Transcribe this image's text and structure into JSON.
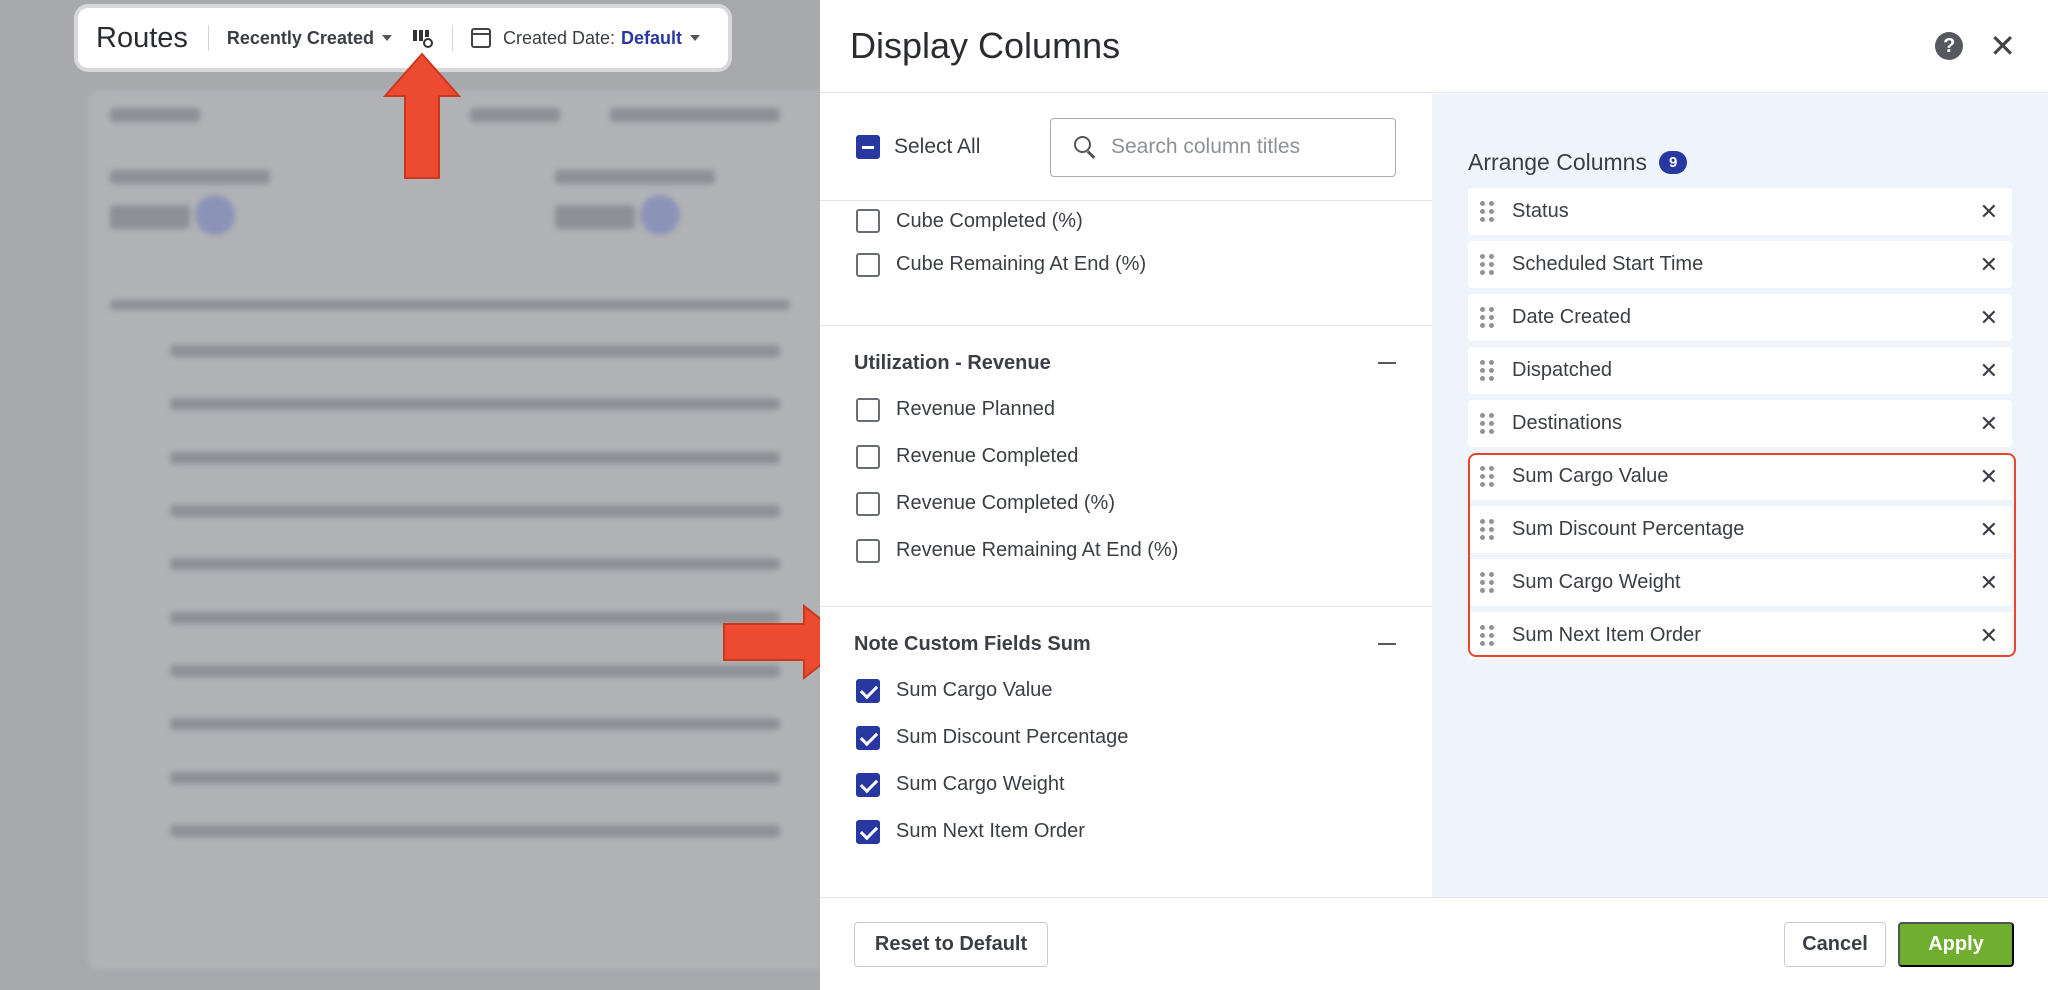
{
  "toolbar": {
    "title": "Routes",
    "sort_label": "Recently Created",
    "date_label": "Created Date:",
    "date_value": "Default",
    "column_settings_icon": "columns-gear-icon",
    "calendar_icon": "calendar-icon"
  },
  "modal": {
    "title": "Display Columns",
    "select_all_label": "Select All",
    "search_placeholder": "Search column titles",
    "groups": [
      {
        "title": "",
        "options": [
          {
            "label": "Cube Completed (%)",
            "checked": false
          },
          {
            "label": "Cube Remaining At End (%)",
            "checked": false
          }
        ]
      },
      {
        "title": "Utilization - Revenue",
        "options": [
          {
            "label": "Revenue Planned",
            "checked": false
          },
          {
            "label": "Revenue Completed",
            "checked": false
          },
          {
            "label": "Revenue Completed (%)",
            "checked": false
          },
          {
            "label": "Revenue Remaining At End (%)",
            "checked": false
          }
        ]
      },
      {
        "title": "Note Custom Fields Sum",
        "options": [
          {
            "label": "Sum Cargo Value",
            "checked": true
          },
          {
            "label": "Sum Discount Percentage",
            "checked": true
          },
          {
            "label": "Sum Cargo Weight",
            "checked": true
          },
          {
            "label": "Sum Next Item Order",
            "checked": true
          }
        ]
      }
    ],
    "arrange": {
      "title": "Arrange Columns",
      "count": "9",
      "columns": [
        "Status",
        "Scheduled Start Time",
        "Date Created",
        "Dispatched",
        "Destinations",
        "Sum Cargo Value",
        "Sum Discount Percentage",
        "Sum Cargo Weight",
        "Sum Next Item Order"
      ]
    },
    "footer": {
      "reset_label": "Reset to Default",
      "cancel_label": "Cancel",
      "apply_label": "Apply"
    }
  },
  "colors": {
    "accent": "#2838a0",
    "apply": "#6fae2f",
    "annotation": "#e8452f"
  }
}
